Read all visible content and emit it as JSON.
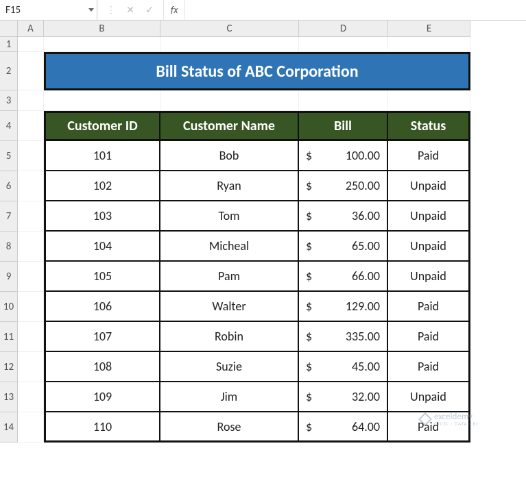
{
  "formula_bar": {
    "name_box": "F15",
    "fx_label": "fx",
    "cancel": "✕",
    "enter": "✓",
    "formula": ""
  },
  "col_headers": [
    "A",
    "B",
    "C",
    "D",
    "E"
  ],
  "row_headers": [
    "1",
    "2",
    "3",
    "4",
    "5",
    "6",
    "7",
    "8",
    "9",
    "10",
    "11",
    "12",
    "13",
    "14"
  ],
  "title": "Bill Status of ABC Corporation",
  "table": {
    "headers": [
      "Customer ID",
      "Customer Name",
      "Bill",
      "Status"
    ],
    "rows": [
      {
        "id": "101",
        "name": "Bob",
        "bill": "100.00",
        "status": "Paid"
      },
      {
        "id": "102",
        "name": "Ryan",
        "bill": "250.00",
        "status": "Unpaid"
      },
      {
        "id": "103",
        "name": "Tom",
        "bill": "36.00",
        "status": "Unpaid"
      },
      {
        "id": "104",
        "name": "Micheal",
        "bill": "65.00",
        "status": "Unpaid"
      },
      {
        "id": "105",
        "name": "Pam",
        "bill": "66.00",
        "status": "Unpaid"
      },
      {
        "id": "106",
        "name": "Walter",
        "bill": "129.00",
        "status": "Paid"
      },
      {
        "id": "107",
        "name": "Robin",
        "bill": "335.00",
        "status": "Paid"
      },
      {
        "id": "108",
        "name": "Suzie",
        "bill": "45.00",
        "status": "Paid"
      },
      {
        "id": "109",
        "name": "Jim",
        "bill": "32.00",
        "status": "Unpaid"
      },
      {
        "id": "110",
        "name": "Rose",
        "bill": "64.00",
        "status": "Paid"
      }
    ]
  },
  "watermark": {
    "brand": "exceldemy",
    "sub": "EXCEL · DATA · BI"
  },
  "currency_symbol": "$"
}
